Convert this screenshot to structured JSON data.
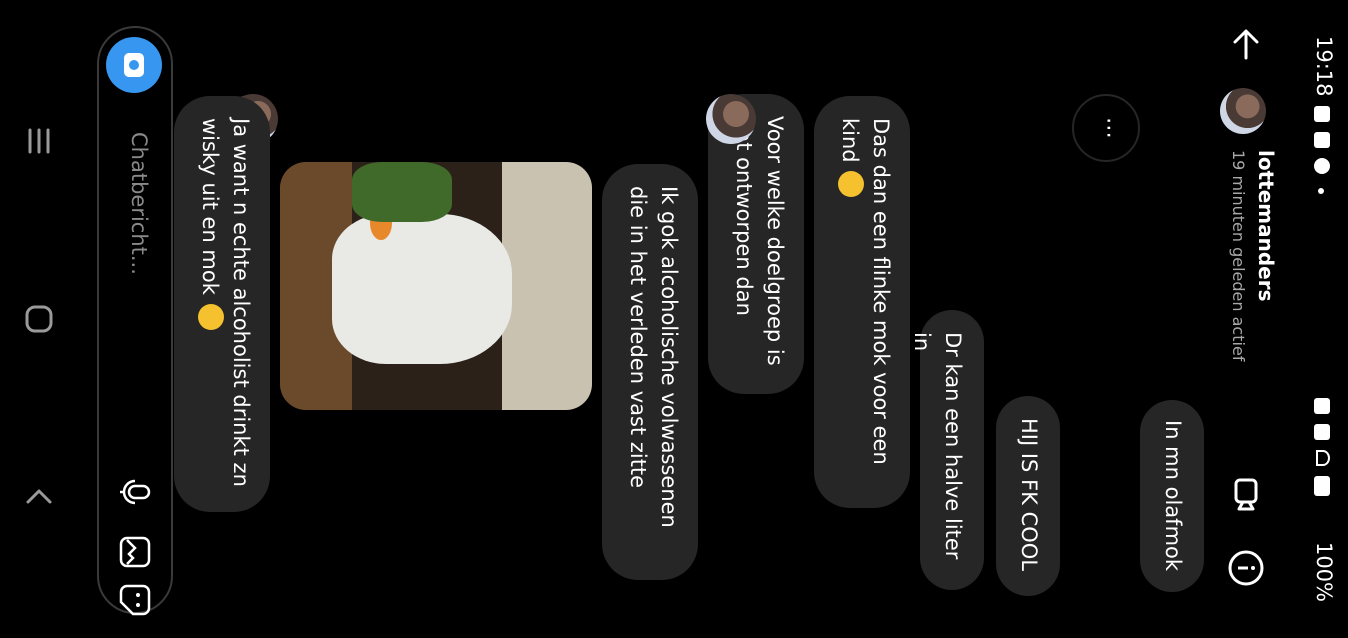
{
  "status_bar": {
    "time": "19:18",
    "battery": "100%"
  },
  "header": {
    "username": "lottemanders",
    "activity": "19 minuten geleden actief"
  },
  "messages": [
    {
      "sender": "me",
      "text": "In mn olafmok"
    },
    {
      "sender": "me",
      "text": "HIJ IS FK COOL"
    },
    {
      "sender": "me",
      "text": "Dr kan een halve liter in"
    },
    {
      "sender": "other",
      "text": "Das dan een flinke mok voor een kind"
    },
    {
      "sender": "other",
      "text": "Voor welke doelgroep is dat ontworpen dan"
    },
    {
      "sender": "me",
      "text": "Ik gok alcoholische volwassenen die in het verleden vast zitte"
    },
    {
      "sender": "other",
      "text": "Ja want n echte alcoholist drinkt zn wisky uit en mok"
    }
  ],
  "typing_indicator": "⋯",
  "composer": {
    "placeholder": "Chatbericht..."
  },
  "icons": {
    "back": "arrow-left-icon",
    "video": "video-call-icon",
    "info": "info-icon",
    "camera": "camera-icon",
    "mic": "microphone-icon",
    "gallery": "gallery-icon",
    "sticker": "sticker-icon",
    "recents": "recent-apps-icon",
    "home": "home-icon",
    "nav_back": "nav-back-icon"
  }
}
